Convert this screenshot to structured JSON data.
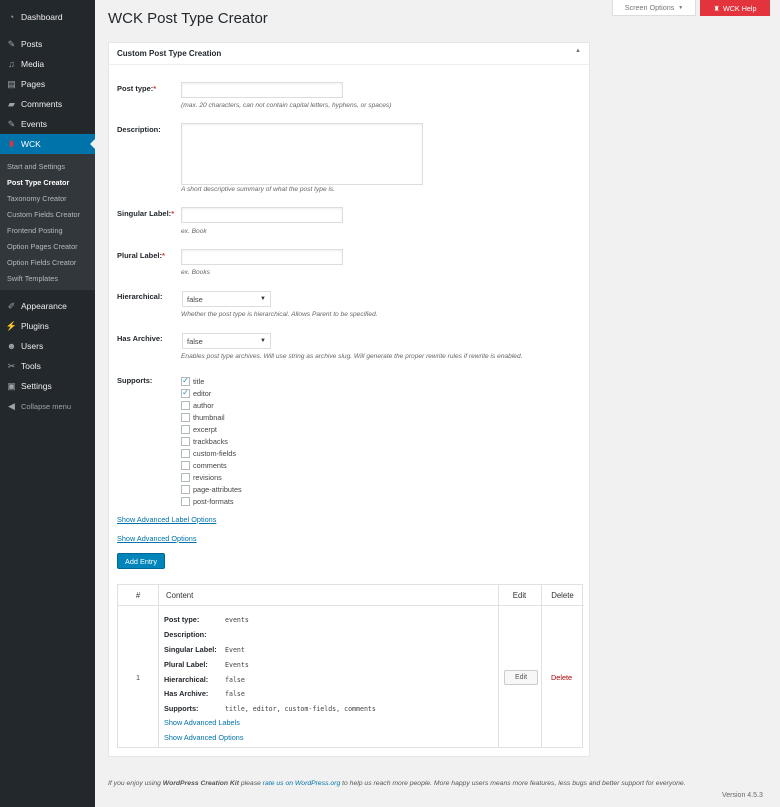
{
  "sidebar": {
    "items": [
      {
        "label": "Dashboard",
        "icon": "dashboard-icon"
      },
      {
        "label": "Posts",
        "icon": "pin-icon"
      },
      {
        "label": "Media",
        "icon": "media-icon"
      },
      {
        "label": "Pages",
        "icon": "pages-icon"
      },
      {
        "label": "Comments",
        "icon": "comments-icon"
      },
      {
        "label": "Events",
        "icon": "pin-icon"
      },
      {
        "label": "WCK",
        "icon": "wck-icon"
      },
      {
        "label": "Appearance",
        "icon": "brush-icon"
      },
      {
        "label": "Plugins",
        "icon": "plugin-icon"
      },
      {
        "label": "Users",
        "icon": "users-icon"
      },
      {
        "label": "Tools",
        "icon": "wrench-icon"
      },
      {
        "label": "Settings",
        "icon": "settings-icon"
      },
      {
        "label": "Collapse menu",
        "icon": "collapse-icon"
      }
    ],
    "wck_submenu": [
      "Start and Settings",
      "Post Type Creator",
      "Taxonomy Creator",
      "Custom Fields Creator",
      "Frontend Posting",
      "Option Pages Creator",
      "Option Fields Creator",
      "Swift Templates"
    ]
  },
  "topbar": {
    "screen_options": "Screen Options",
    "wck_help": "WCK Help"
  },
  "page": {
    "title": "WCK Post Type Creator"
  },
  "postbox": {
    "title": "Custom Post Type Creation",
    "fields": {
      "post_type": {
        "label": "Post type:",
        "value": "",
        "help": "(max. 20 characters, can not contain capital letters, hyphens, or spaces)"
      },
      "description": {
        "label": "Description:",
        "value": "",
        "help": "A short descriptive summary of what the post type is."
      },
      "singular_label": {
        "label": "Singular Label:",
        "value": "",
        "help": "ex. Book"
      },
      "plural_label": {
        "label": "Plural Label:",
        "value": "",
        "help": "ex. Books"
      },
      "hierarchical": {
        "label": "Hierarchical:",
        "selected": "false",
        "help": "Whether the post type is hierarchical. Allows Parent to be specified."
      },
      "has_archive": {
        "label": "Has Archive:",
        "selected": "false",
        "help": "Enables post type archives. Will use string as archive slug. Will generate the proper rewrite rules if rewrite is enabled."
      },
      "supports": {
        "label": "Supports:",
        "options": [
          {
            "label": "title",
            "checked": true
          },
          {
            "label": "editor",
            "checked": true
          },
          {
            "label": "author",
            "checked": false
          },
          {
            "label": "thumbnail",
            "checked": false
          },
          {
            "label": "excerpt",
            "checked": false
          },
          {
            "label": "trackbacks",
            "checked": false
          },
          {
            "label": "custom-fields",
            "checked": false
          },
          {
            "label": "comments",
            "checked": false
          },
          {
            "label": "revisions",
            "checked": false
          },
          {
            "label": "page-attributes",
            "checked": false
          },
          {
            "label": "post-formats",
            "checked": false
          }
        ]
      }
    },
    "show_advanced_label_options": "Show Advanced Label Options",
    "show_advanced_options": "Show Advanced Options",
    "add_entry": "Add Entry"
  },
  "entries_table": {
    "headers": {
      "num": "#",
      "content": "Content",
      "edit": "Edit",
      "delete": "Delete"
    },
    "rows": [
      {
        "num": "1",
        "fields": [
          {
            "label": "Post type:",
            "value": "events"
          },
          {
            "label": "Description:",
            "value": ""
          },
          {
            "label": "Singular Label:",
            "value": "Event"
          },
          {
            "label": "Plural Label:",
            "value": "Events"
          },
          {
            "label": "Hierarchical:",
            "value": "false"
          },
          {
            "label": "Has Archive:",
            "value": "false"
          },
          {
            "label": "Supports:",
            "value": "title, editor, custom-fields, comments"
          }
        ],
        "show_advanced_labels": "Show Advanced Labels",
        "show_advanced_options": "Show Advanced Options",
        "edit": "Edit",
        "delete": "Delete"
      }
    ]
  },
  "footer": {
    "text_before": "If you enjoy using ",
    "plugin_name": "WordPress Creation Kit",
    "text_mid": " please ",
    "rate_link": "rate us on WordPress.org",
    "text_after": " to help us reach more people. More happy users means more features, less bugs and better support for everyone.",
    "version": "Version 4.5.3"
  },
  "colors": {
    "sidebar_bg": "#23282d",
    "submenu_bg": "#32373c",
    "active_blue": "#0073aa",
    "help_red": "#e3343d",
    "delete_red": "#aa0000"
  }
}
